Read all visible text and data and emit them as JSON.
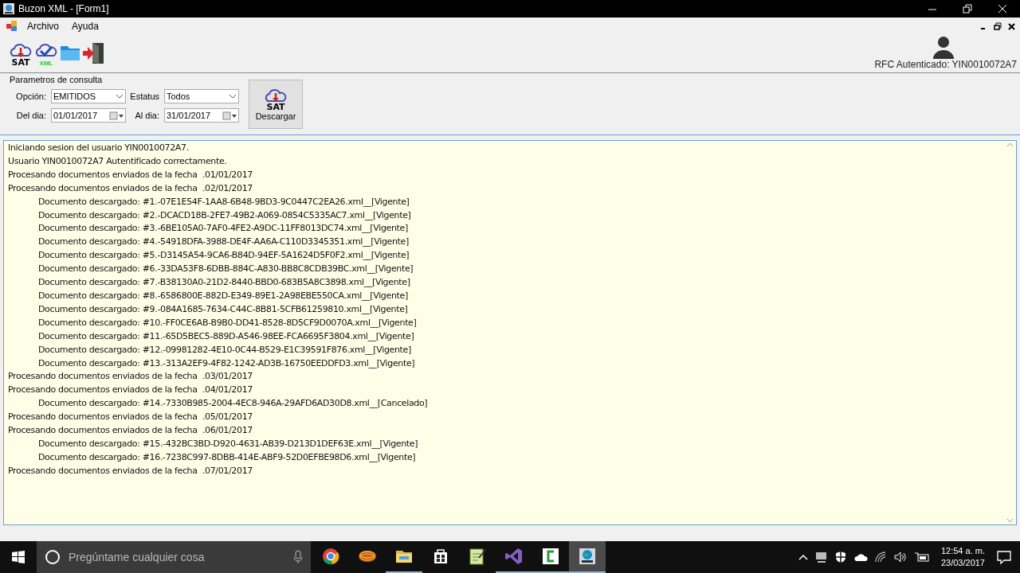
{
  "window": {
    "title": "Buzon XML - [Form1]"
  },
  "menu": [
    "Archivo",
    "Ayuda"
  ],
  "toolbar": {
    "sat_label": "SAT",
    "xml_label": "XML"
  },
  "user": {
    "rfc": "RFC Autenticado: YIN0010072A7"
  },
  "params": {
    "title": "Parametros de consulta",
    "fields": [
      {
        "label": "Opción:",
        "value": "EMITIDOS",
        "kind": "dropdown"
      },
      {
        "label": "Estatus",
        "value": "Todos",
        "kind": "dropdown"
      },
      {
        "label": "Del dia:",
        "value": "01/01/2017",
        "kind": "date"
      },
      {
        "label": "Al dia:",
        "value": "31/01/2017",
        "kind": "date"
      }
    ],
    "button": {
      "icon_label": "SAT",
      "label": "Descargar"
    }
  },
  "log": [
    {
      "kind": "info",
      "text": "Iniciando sesion del usuario YIN0010072A7."
    },
    {
      "kind": "info",
      "text": "Usuario YIN0010072A7 Autentificado correctamente."
    },
    {
      "kind": "info",
      "text": "Procesando documentos enviados de la fecha  .01/01/2017"
    },
    {
      "kind": "info",
      "text": "Procesando documentos enviados de la fecha  .02/01/2017"
    },
    {
      "kind": "doc",
      "text": "Documento descargado: #1.-07E1E54F-1AA8-6B48-9BD3-9C0447C2EA26.xml__[Vigente]"
    },
    {
      "kind": "doc",
      "text": "Documento descargado: #2.-DCACD18B-2FE7-49B2-A069-0854C5335AC7.xml__[Vigente]"
    },
    {
      "kind": "doc",
      "text": "Documento descargado: #3.-6BE105A0-7AF0-4FE2-A9DC-11FF8013DC74.xml__[Vigente]"
    },
    {
      "kind": "doc",
      "text": "Documento descargado: #4.-54918DFA-3988-DE4F-AA6A-C110D3345351.xml__[Vigente]"
    },
    {
      "kind": "doc",
      "text": "Documento descargado: #5.-D3145A54-9CA6-B84D-94EF-5A1624D5F0F2.xml__[Vigente]"
    },
    {
      "kind": "doc",
      "text": "Documento descargado: #6.-33DA53F8-6DBB-884C-A830-BB8C8CDB39BC.xml__[Vigente]"
    },
    {
      "kind": "doc",
      "text": "Documento descargado: #7.-B38130A0-21D2-8440-BBD0-683B5A8C3898.xml__[Vigente]"
    },
    {
      "kind": "doc",
      "text": "Documento descargado: #8.-6586800E-882D-E349-89E1-2A98EBE550CA.xml__[Vigente]"
    },
    {
      "kind": "doc",
      "text": "Documento descargado: #9.-084A1685-7634-C44C-8B81-5CFB61259810.xml__[Vigente]"
    },
    {
      "kind": "doc",
      "text": "Documento descargado: #10.-FF0CE6AB-B9B0-DD41-8528-8D5CF9D0070A.xml__[Vigente]"
    },
    {
      "kind": "doc",
      "text": "Documento descargado: #11.-65D5BEC5-889D-A546-98EE-FCA6695F3804.xml__[Vigente]"
    },
    {
      "kind": "doc",
      "text": "Documento descargado: #12.-09981282-4E10-0C44-B529-E1C39591F876.xml__[Vigente]"
    },
    {
      "kind": "doc",
      "text": "Documento descargado: #13.-313A2EF9-4F82-1242-AD3B-16750EEDDFD3.xml__[Vigente]"
    },
    {
      "kind": "info",
      "text": "Procesando documentos enviados de la fecha  .03/01/2017"
    },
    {
      "kind": "info",
      "text": "Procesando documentos enviados de la fecha  .04/01/2017"
    },
    {
      "kind": "doc",
      "text": "Documento descargado: #14.-7330B985-2004-4EC8-946A-29AFD6AD30D8.xml__[Cancelado]"
    },
    {
      "kind": "info",
      "text": "Procesando documentos enviados de la fecha  .05/01/2017"
    },
    {
      "kind": "info",
      "text": "Procesando documentos enviados de la fecha  .06/01/2017"
    },
    {
      "kind": "doc",
      "text": "Documento descargado: #15.-432BC3BD-D920-4631-AB39-D213D1DEF63E.xml__[Vigente]"
    },
    {
      "kind": "doc",
      "text": "Documento descargado: #16.-7238C997-8DBB-414E-ABF9-52D0EFBE98D6.xml__[Vigente]"
    },
    {
      "kind": "info",
      "text": "Procesando documentos enviados de la fecha  .07/01/2017"
    }
  ],
  "taskbar": {
    "search_placeholder": "Pregúntame cualquier cosa",
    "apps": [
      {
        "kind": "browser",
        "running": false,
        "selected": false
      },
      {
        "kind": "coil",
        "running": false,
        "selected": false
      },
      {
        "kind": "folder",
        "running": true,
        "selected": false
      },
      {
        "kind": "store",
        "running": false,
        "selected": false
      },
      {
        "kind": "notepad",
        "running": false,
        "selected": false
      },
      {
        "kind": "studio",
        "running": true,
        "selected": false
      },
      {
        "kind": "recorder",
        "running": true,
        "selected": false
      },
      {
        "kind": "globe",
        "running": true,
        "selected": true
      }
    ],
    "time": "12:54 a. m.",
    "date": "23/03/2017"
  }
}
